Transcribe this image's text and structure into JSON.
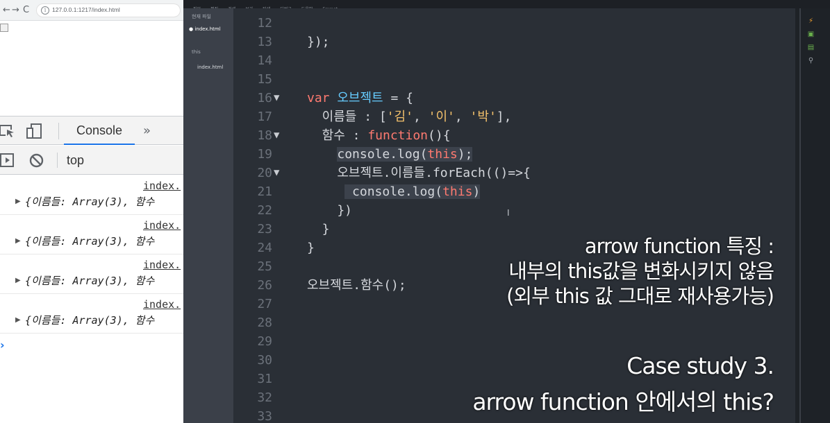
{
  "browser": {
    "back": "←",
    "forward": "→",
    "reload": "C",
    "url": "127.0.0.1:1217/index.html",
    "devtools": {
      "tab_console": "Console",
      "more_tabs": "»",
      "context": "top",
      "logs": [
        {
          "source": "index.",
          "text": "{이름들: Array(3), 함수"
        },
        {
          "source": "index.",
          "text": "{이름들: Array(3), 함수"
        },
        {
          "source": "index.",
          "text": "{이름들: Array(3), 함수"
        },
        {
          "source": "index.",
          "text": "{이름들: Array(3), 함수"
        }
      ],
      "prompt": "›"
    }
  },
  "editor": {
    "menu": [
      "파일",
      "편집",
      "검색",
      "보기",
      "탐색",
      "디버그",
      "도움말",
      "Emmet"
    ],
    "working_files_label": "현재 파일",
    "active_file": "index.html",
    "project_label": "this",
    "project_file": "index.html",
    "lines": [
      {
        "n": "12",
        "fold": false,
        "segs": []
      },
      {
        "n": "13",
        "fold": false,
        "segs": [
          {
            "t": "});",
            "c": ""
          }
        ]
      },
      {
        "n": "14",
        "fold": false,
        "segs": []
      },
      {
        "n": "15",
        "fold": false,
        "segs": []
      },
      {
        "n": "16",
        "fold": true,
        "segs": [
          {
            "t": "var ",
            "c": "kw"
          },
          {
            "t": "오브젝트",
            "c": "var"
          },
          {
            "t": " = {",
            "c": ""
          }
        ]
      },
      {
        "n": "17",
        "fold": false,
        "segs": [
          {
            "t": "  이름들 : [",
            "c": ""
          },
          {
            "t": "'김'",
            "c": "str"
          },
          {
            "t": ", ",
            "c": ""
          },
          {
            "t": "'이'",
            "c": "str"
          },
          {
            "t": ", ",
            "c": ""
          },
          {
            "t": "'박'",
            "c": "str"
          },
          {
            "t": "],",
            "c": ""
          }
        ]
      },
      {
        "n": "18",
        "fold": true,
        "segs": [
          {
            "t": "  함수 : ",
            "c": ""
          },
          {
            "t": "function",
            "c": "kw"
          },
          {
            "t": "(){",
            "c": ""
          }
        ]
      },
      {
        "n": "19",
        "fold": false,
        "segs": [
          {
            "t": "    ",
            "c": ""
          },
          {
            "t": "console.log(",
            "c": "hl"
          },
          {
            "t": "this",
            "c": "kw hl"
          },
          {
            "t": ");",
            "c": "hl"
          }
        ]
      },
      {
        "n": "20",
        "fold": true,
        "segs": [
          {
            "t": "    오브젝트.이름들.forEach(()=>{",
            "c": ""
          }
        ]
      },
      {
        "n": "21",
        "fold": false,
        "segs": [
          {
            "t": "     ",
            "c": ""
          },
          {
            "t": " console.log(",
            "c": "hl"
          },
          {
            "t": "this",
            "c": "kw hl"
          },
          {
            "t": ")",
            "c": "hl"
          }
        ]
      },
      {
        "n": "22",
        "fold": false,
        "segs": [
          {
            "t": "    })",
            "c": ""
          }
        ]
      },
      {
        "n": "23",
        "fold": false,
        "segs": [
          {
            "t": "  }",
            "c": ""
          }
        ]
      },
      {
        "n": "24",
        "fold": false,
        "segs": [
          {
            "t": "}",
            "c": ""
          }
        ]
      },
      {
        "n": "25",
        "fold": false,
        "segs": []
      },
      {
        "n": "26",
        "fold": false,
        "segs": [
          {
            "t": "오브젝트.함수();",
            "c": ""
          }
        ]
      },
      {
        "n": "27",
        "fold": false,
        "segs": []
      },
      {
        "n": "28",
        "fold": false,
        "segs": []
      },
      {
        "n": "29",
        "fold": false,
        "segs": []
      },
      {
        "n": "30",
        "fold": false,
        "segs": []
      },
      {
        "n": "31",
        "fold": false,
        "segs": []
      },
      {
        "n": "32",
        "fold": false,
        "segs": []
      },
      {
        "n": "33",
        "fold": false,
        "segs": []
      }
    ]
  },
  "captions": {
    "line1": "arrow function 특징 :",
    "line2": "내부의 this값을 변화시키지 않음",
    "line3": "(외부 this 값 그대로 재사용가능)",
    "line4": "Case study 3.",
    "line5": "arrow function 안에서의 this?"
  }
}
